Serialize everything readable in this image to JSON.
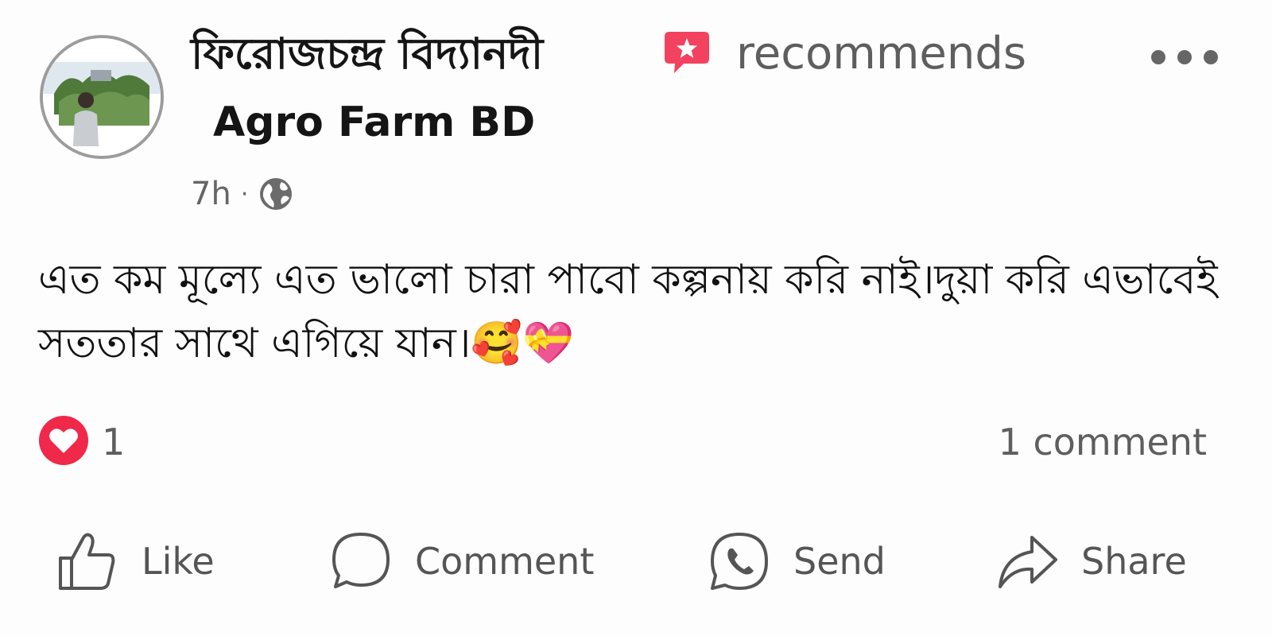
{
  "post": {
    "author": "ফিরোজচন্দ্র বিদ্যানদী",
    "action_text": "recommends",
    "page_name": "Agro Farm BD",
    "time": "7h",
    "separator": "·",
    "privacy_icon": "globe-icon",
    "text": "এত কম মূল্যে এত ভালো চারা পাবো কল্পনায় করি নাই।দুয়া করি এভাবেই সততার সাথে এগিয়ে যান।🥰💝"
  },
  "reactions": {
    "icon": "love-reaction-icon",
    "count": "1",
    "comments": "1 comment"
  },
  "actions": {
    "like": "Like",
    "comment": "Comment",
    "send": "Send",
    "share": "Share"
  },
  "colors": {
    "love_red": "#f02849",
    "recommend_red": "#f3425f",
    "icon_gray": "#555555"
  }
}
